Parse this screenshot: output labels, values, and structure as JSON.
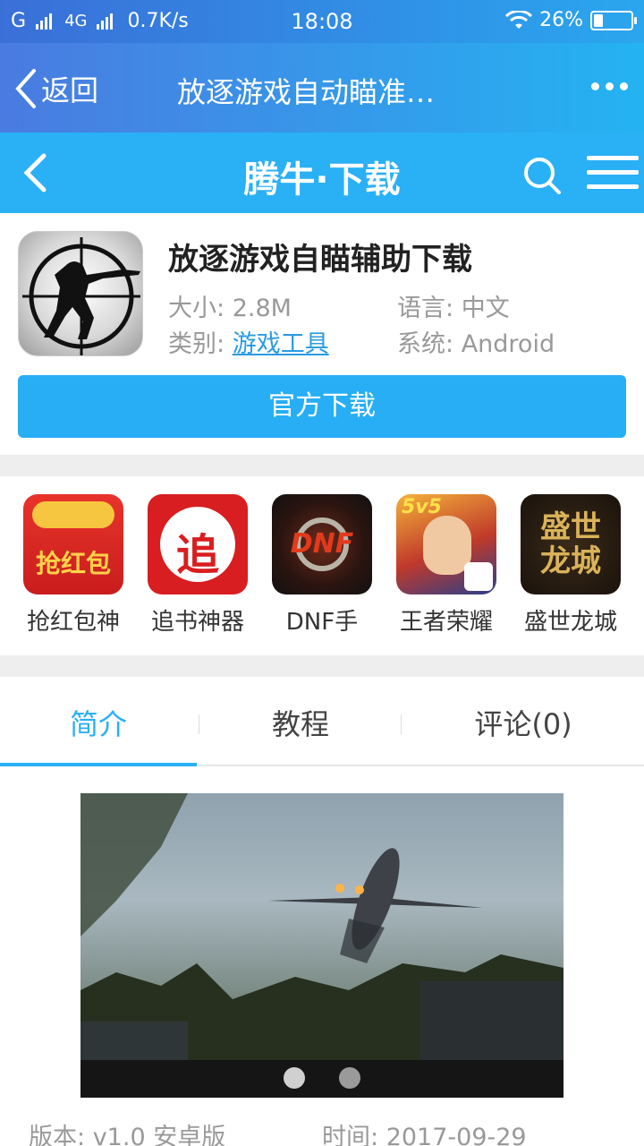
{
  "status_bar": {
    "carrier1": "G",
    "carrier2": "4G",
    "speed": "0.7K/s",
    "time": "18:08",
    "battery_text": "26%",
    "battery_level": 0.26
  },
  "browser": {
    "back_label": "返回",
    "title": "放逐游戏自动瞄准…"
  },
  "site": {
    "title": "腾牛·下载"
  },
  "app": {
    "name": "放逐游戏自瞄辅助下载",
    "size_label": "大小:",
    "size_value": "2.8M",
    "language_label": "语言:",
    "language_value": "中文",
    "category_label": "类别:",
    "category_value": "游戏工具",
    "system_label": "系统:",
    "system_value": "Android",
    "download_label": "官方下载"
  },
  "recommended": [
    {
      "label": "抢红包神",
      "icon_text": "抢红包"
    },
    {
      "label": "追书神器",
      "icon_text": "追"
    },
    {
      "label": "DNF手",
      "icon_text": "DNF"
    },
    {
      "label": "王者荣耀",
      "icon_text": "5v5"
    },
    {
      "label": "盛世龙城",
      "icon_text": "盛世龙城"
    }
  ],
  "tabs": [
    {
      "label": "简介"
    },
    {
      "label": "教程"
    },
    {
      "label": "评论(0)"
    }
  ],
  "footer": {
    "version_label": "版本:",
    "version_value": "v1.0 安卓版",
    "time_label": "时间:",
    "time_value": "2017-09-29"
  },
  "colors": {
    "accent": "#2ab0f5",
    "link": "#2a9be0"
  }
}
